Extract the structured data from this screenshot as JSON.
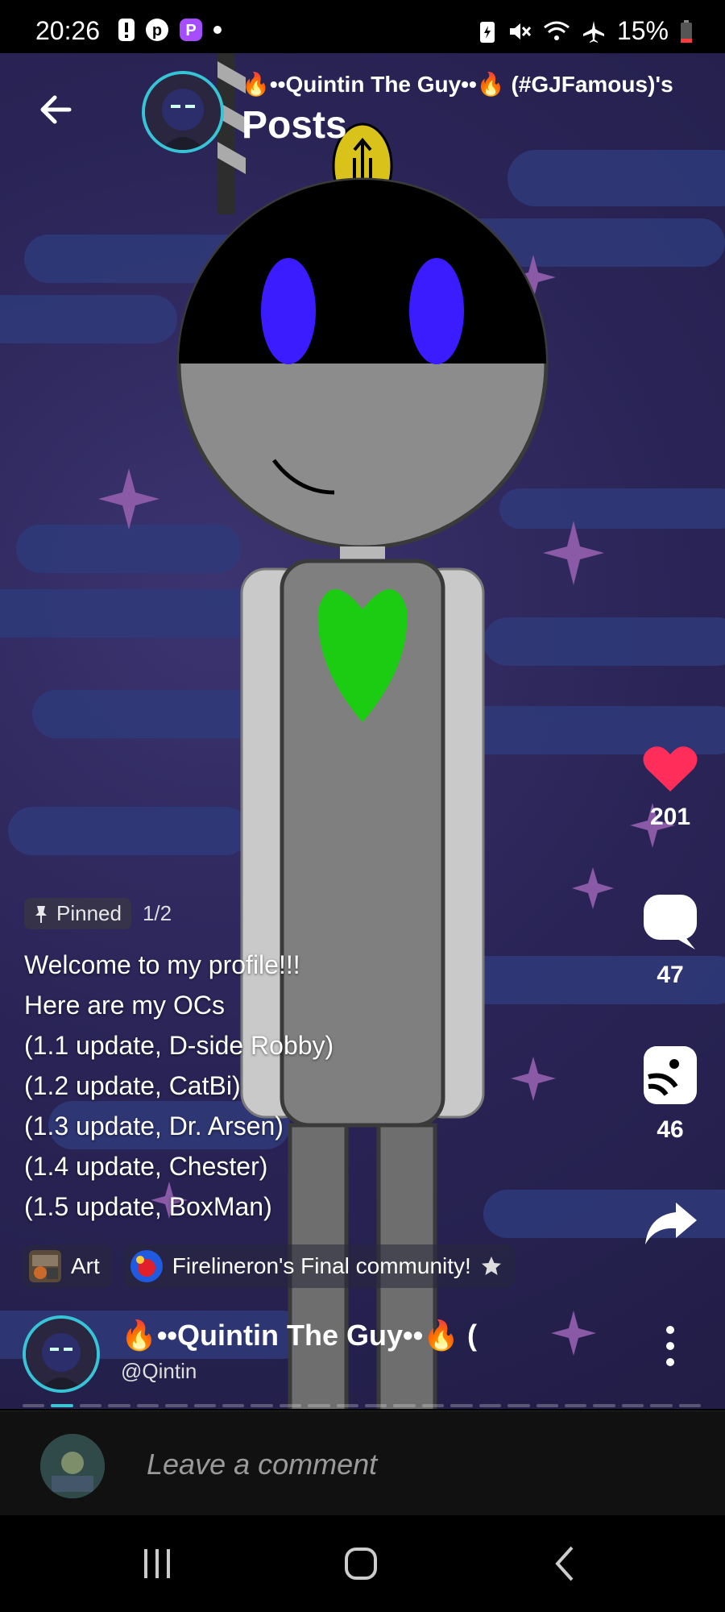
{
  "status_bar": {
    "time": "20:26",
    "battery_percent": "15%"
  },
  "header": {
    "title": "🔥••Quintin The Guy••🔥 (#GJFamous)'s",
    "subtitle": "Posts"
  },
  "actions": {
    "likes": "201",
    "comments": "47",
    "reposts": "46"
  },
  "post": {
    "pinned_label": "Pinned",
    "pinned_count": "1/2",
    "lines": [
      "Welcome to my profile!!!",
      "Here are my OCs",
      "(1.1 update, D-side Robby)",
      "(1.2 update, CatBi)",
      "(1.3 update, Dr. Arsen)",
      "(1.4 update, Chester)",
      "(1.5 update, BoxMan)"
    ]
  },
  "tags": [
    {
      "label": "Art"
    },
    {
      "label": "Firelineron's Final community!"
    }
  ],
  "author": {
    "name": "🔥••Quintin The Guy••🔥 (",
    "handle": "@Qintin"
  },
  "comment": {
    "placeholder": "Leave a comment"
  },
  "colors": {
    "accent": "#36c4d6",
    "like": "#ff2d5a",
    "background": "#2b2558"
  },
  "icons": [
    "back-arrow-icon",
    "heart-icon",
    "comment-bubble-icon",
    "repost-icon",
    "share-icon",
    "pin-icon",
    "star-icon",
    "more-vertical-icon",
    "recent-apps-icon",
    "home-icon",
    "back-icon"
  ]
}
